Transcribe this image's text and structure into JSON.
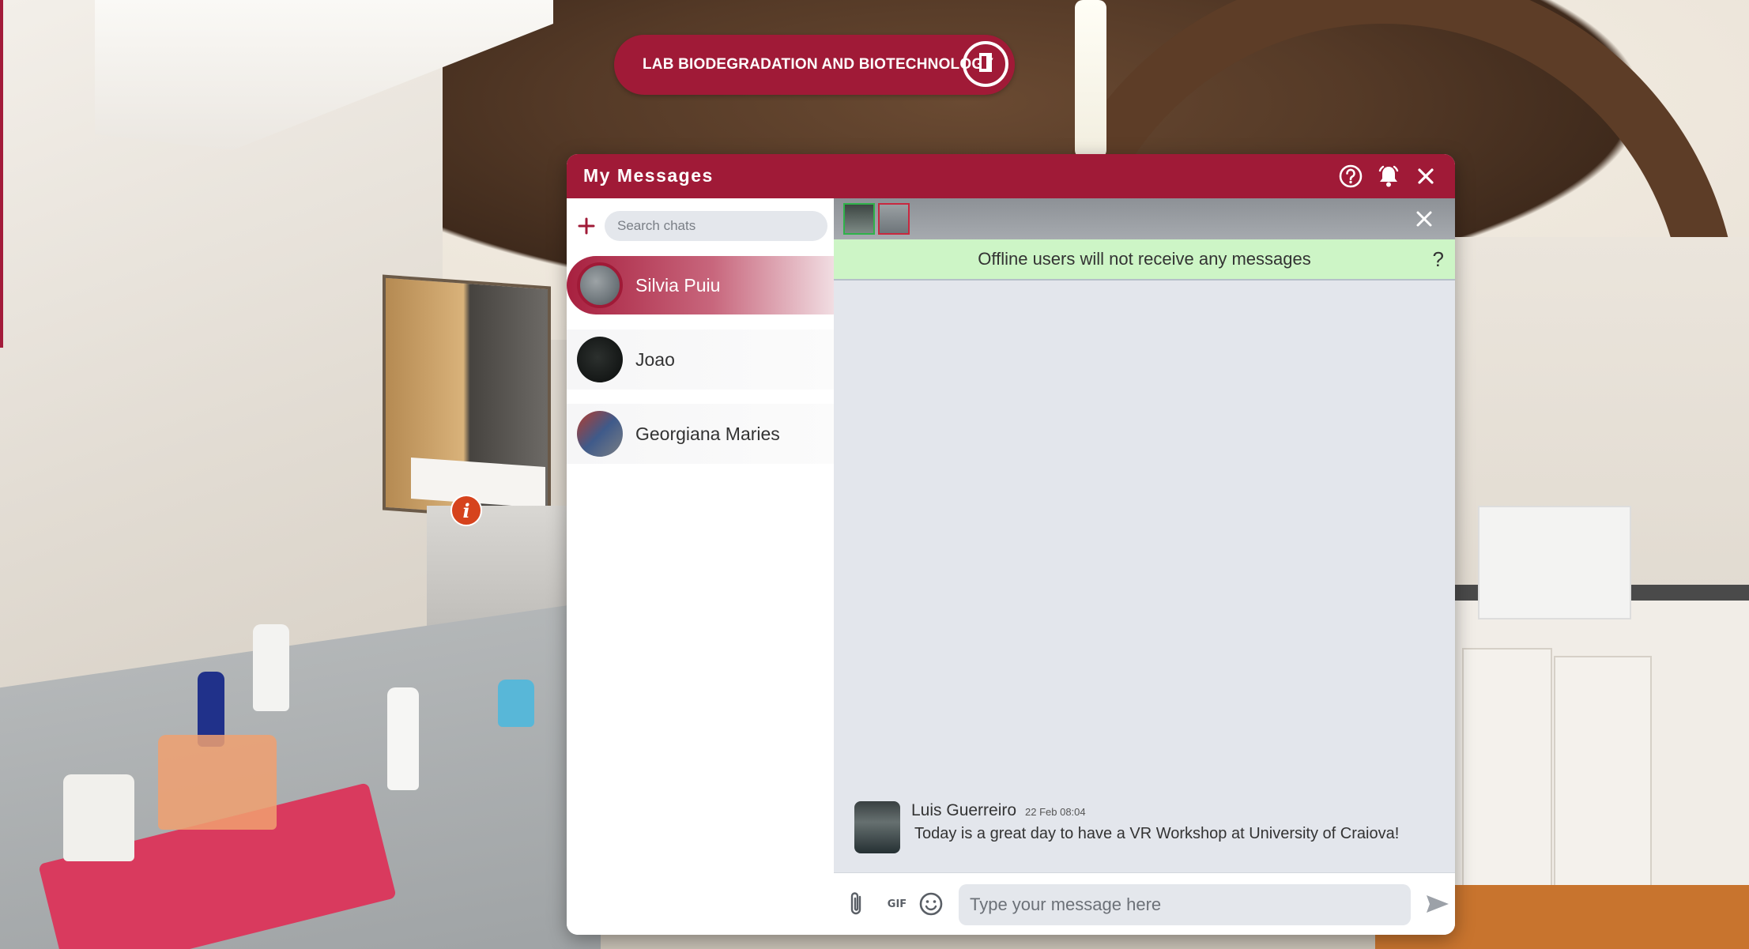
{
  "banner": {
    "label": "LAB BIODEGRADATION AND BIOTECHNOLOGY",
    "exit_icon": "exit-door-icon"
  },
  "hotspot": {
    "glyph": "i",
    "icon": "info-icon"
  },
  "window": {
    "title": "My Messages",
    "header_icons": [
      "help-circle-icon",
      "bell-icon",
      "close-icon"
    ],
    "accent_color": "#a01a37"
  },
  "sidebar": {
    "search_placeholder": "Search chats",
    "chats": [
      {
        "name": "Silvia Puiu",
        "active": true
      },
      {
        "name": "Joao",
        "active": false
      },
      {
        "name": "Georgiana Maries",
        "active": false
      }
    ]
  },
  "chat": {
    "notice": "Offline users will not receive any messages",
    "notice_help": "?",
    "messages": [
      {
        "author": "Luis Guerreiro",
        "time": "22 Feb 08:04",
        "text": "Today is a great day to have a VR Workshop at University of Craiova!"
      }
    ],
    "composer": {
      "placeholder": "Type your message here",
      "gif_label": "GIF",
      "icons": [
        "paperclip-icon",
        "gif-icon",
        "emoji-icon",
        "send-icon"
      ]
    }
  }
}
